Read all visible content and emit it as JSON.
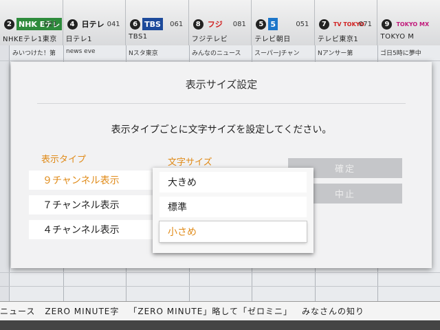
{
  "channels": [
    {
      "num": "2",
      "logo": "NHK Eテレ",
      "code": "021",
      "name": "NHKEテレ1東京",
      "logo_bg": "#2e8b3c",
      "logo_fg": "#ffffff"
    },
    {
      "num": "4",
      "logo": "日テレ",
      "code": "041",
      "name": "日テレ1",
      "logo_bg": "transparent",
      "logo_fg": "#111111"
    },
    {
      "num": "6",
      "logo": "TBS",
      "code": "061",
      "name": "TBS1",
      "logo_bg": "#1d4a9b",
      "logo_fg": "#ffffff"
    },
    {
      "num": "8",
      "logo": "フジ",
      "code": "081",
      "name": "フジテレビ",
      "logo_bg": "transparent",
      "logo_fg": "#d02020"
    },
    {
      "num": "5",
      "logo": "5",
      "code": "051",
      "name": "テレビ朝日",
      "logo_bg": "#1d76c9",
      "logo_fg": "#ffffff"
    },
    {
      "num": "7",
      "logo": "TV TOKYO",
      "code": "071",
      "name": "テレビ東京1",
      "logo_bg": "transparent",
      "logo_fg": "#d02020"
    },
    {
      "num": "9",
      "logo": "TOKYO MX",
      "code": "",
      "name": "TOKYO M",
      "logo_bg": "transparent",
      "logo_fg": "#c0187a"
    }
  ],
  "grid_titles": [
    "みいつけた！第",
    "news eve",
    "Nスタ東京",
    "みんなのニュース",
    "スーパーJチャン",
    "Nアンサー第",
    "ゴ日5時に夢中"
  ],
  "ticker": {
    "items": [
      "ニュース",
      "ZERO MINUTE字",
      "「ZERO MINUTE」略して「ゼロミニ」",
      "みなさんの知り"
    ]
  },
  "dialog": {
    "title": "表示サイズ設定",
    "instruction": "表示タイプごとに文字サイズを設定してください。",
    "type_header": "表示タイプ",
    "size_header": "文字サイズ",
    "types": [
      "９チャンネル表示",
      "７チャンネル表示",
      "４チャンネル表示"
    ],
    "confirm_label": "確定",
    "cancel_label": "中止"
  },
  "dropdown": {
    "options": [
      "大きめ",
      "標準",
      "小さめ"
    ],
    "selected_index": 2
  },
  "colors": {
    "accent": "#e08a17",
    "dialog_bg": "#f2f2f3",
    "disabled_button": "#c5c6c9"
  }
}
